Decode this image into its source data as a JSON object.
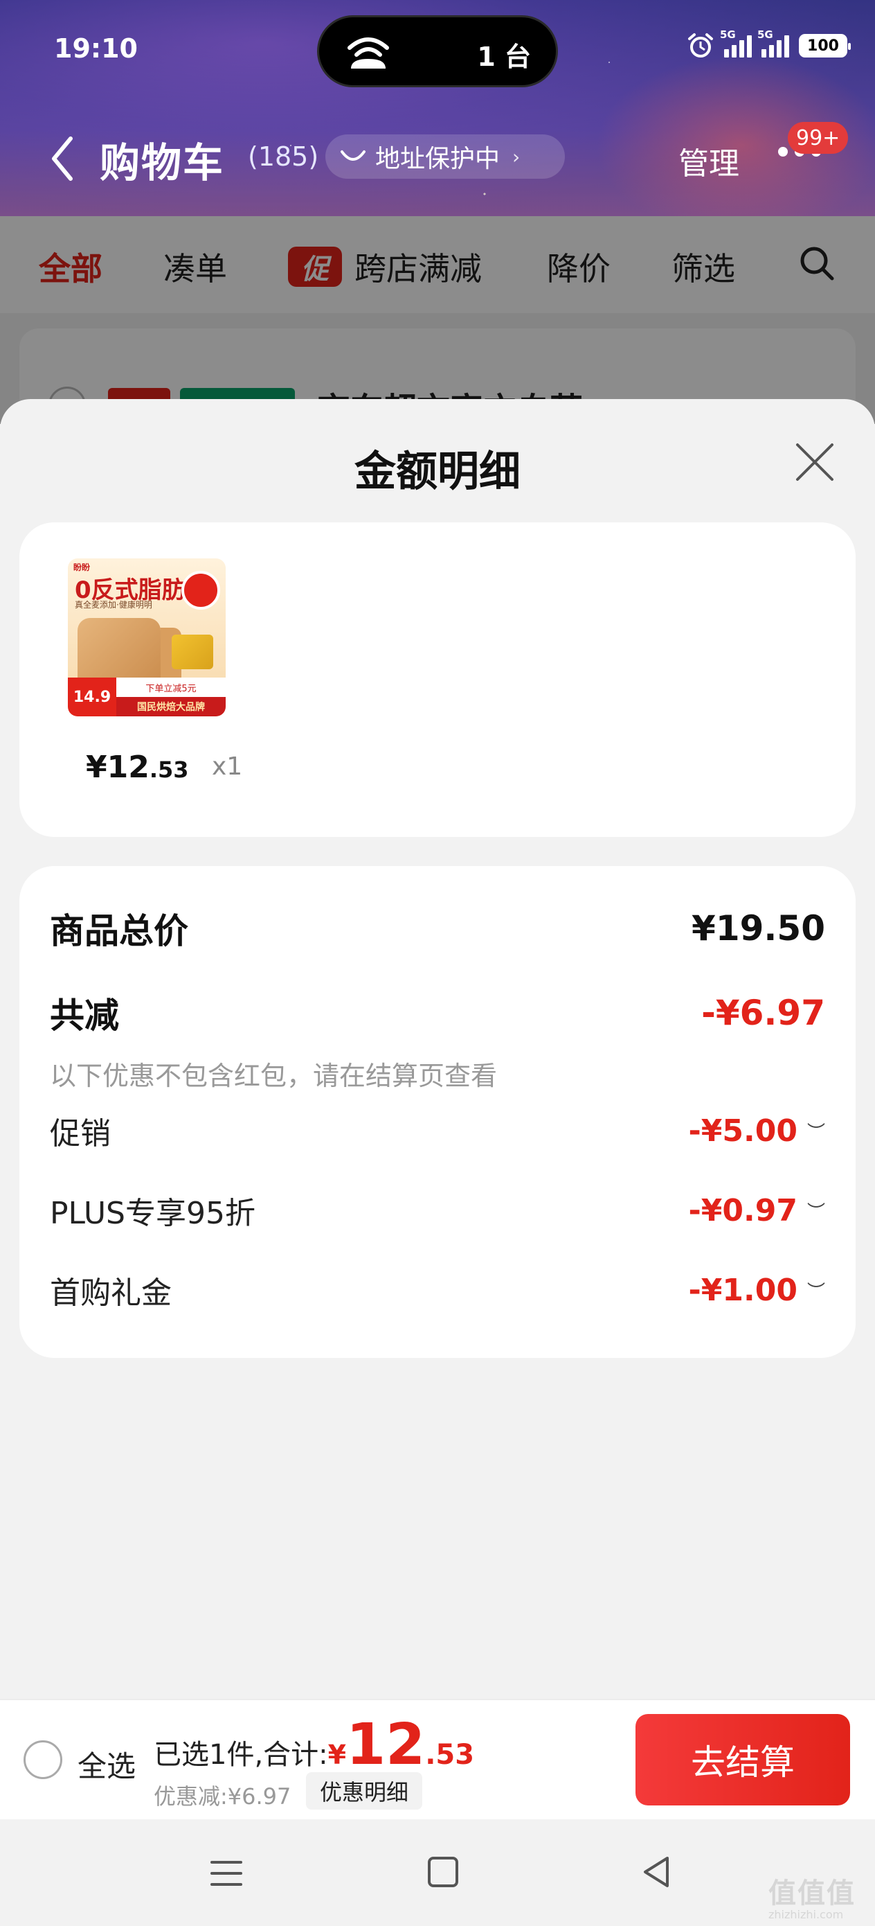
{
  "status_bar": {
    "time": "19:10",
    "island_devices": "1 台",
    "sig1_label": "5G",
    "sig2_label": "5G",
    "battery": "100"
  },
  "nav": {
    "title": "购物车",
    "count": "(185)",
    "address_protect": "地址保护中",
    "manage": "管理",
    "badge": "99+"
  },
  "tabs": {
    "all": "全部",
    "cou": "凑单",
    "promo_icon": "促",
    "promo": "跨店满减",
    "price_drop": "降价",
    "filter": "筛选"
  },
  "peek": {
    "title": "京东超市官方自营"
  },
  "sheet": {
    "title": "金额明细",
    "product": {
      "thumb_brand": "盼盼",
      "thumb_headline": "0反式脂肪酸",
      "thumb_sub": "真全麦添加·健康明明",
      "thumb_price": "14.9",
      "thumb_promo": "下单立减5元",
      "thumb_slogan": "国民烘焙大品牌",
      "price_main": "¥12",
      "price_cents": ".53",
      "qty": "x1"
    },
    "detail": {
      "total_label": "商品总价",
      "total_value": "¥19.50",
      "reduce_label": "共减",
      "reduce_value": "-¥6.97",
      "note": "以下优惠不包含红包，请在结算页查看",
      "items": [
        {
          "label": "促销",
          "value": "-¥5.00"
        },
        {
          "label": "PLUS专享95折",
          "value": "-¥0.97"
        },
        {
          "label": "首购礼金",
          "value": "-¥1.00"
        }
      ]
    }
  },
  "checkout": {
    "select_all": "全选",
    "summary_label": "已选1件,合计:",
    "yen": "¥",
    "amount_int": "12",
    "amount_dec": ".53",
    "discount": "优惠减:¥6.97",
    "detail_button": "优惠明细",
    "checkout_button": "去结算"
  },
  "watermark": {
    "main": "值值值",
    "sub": "zhizhizhi.com"
  }
}
